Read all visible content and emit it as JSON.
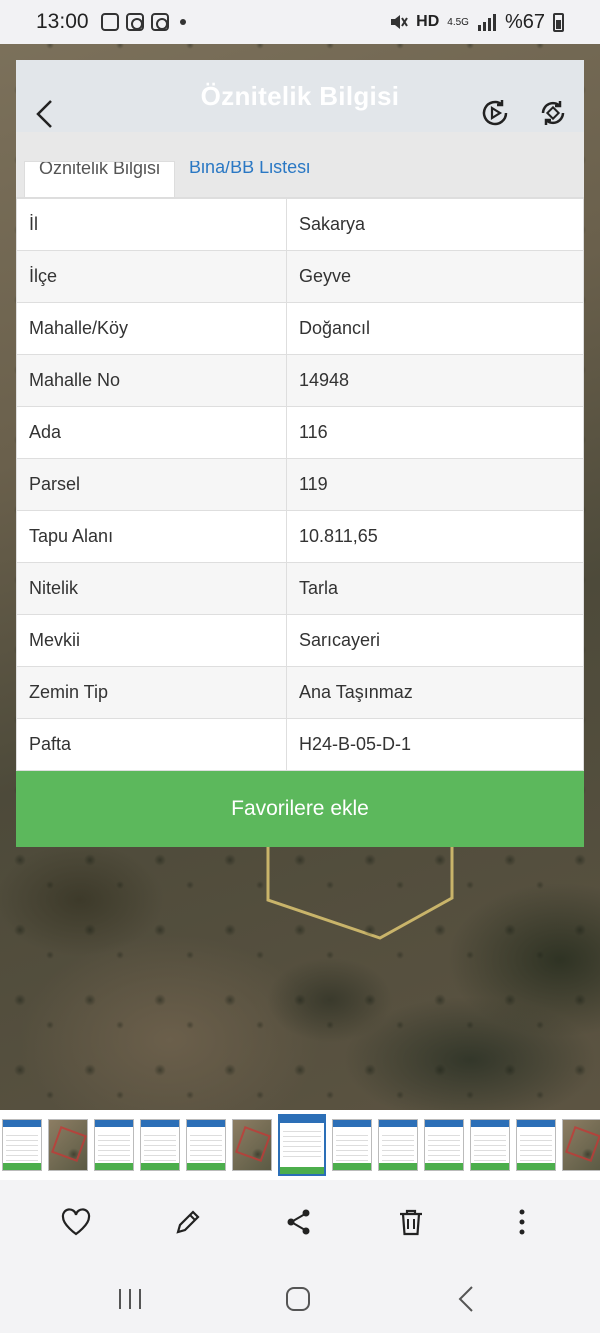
{
  "status_bar": {
    "time": "13:00",
    "network": "HD",
    "network_sub": "4.5G",
    "battery": "%67"
  },
  "app_bar": {
    "title": "Öznitelik Bilgisi"
  },
  "tabs": [
    {
      "label": "Öznitelik Bilgisi",
      "active": true
    },
    {
      "label": "Bina/BB Listesi",
      "active": false
    }
  ],
  "attributes": [
    {
      "key": "İl",
      "value": "Sakarya"
    },
    {
      "key": "İlçe",
      "value": "Geyve"
    },
    {
      "key": "Mahalle/Köy",
      "value": "Doğancıl"
    },
    {
      "key": "Mahalle No",
      "value": "14948"
    },
    {
      "key": "Ada",
      "value": "116"
    },
    {
      "key": "Parsel",
      "value": "119"
    },
    {
      "key": "Tapu Alanı",
      "value": "10.811,65"
    },
    {
      "key": "Nitelik",
      "value": "Tarla"
    },
    {
      "key": "Mevkii",
      "value": "Sarıcayeri"
    },
    {
      "key": "Zemin Tip",
      "value": "Ana Taşınmaz"
    },
    {
      "key": "Pafta",
      "value": "H24-B-05-D-1"
    }
  ],
  "favorite_button": {
    "label": "Favorilere ekle"
  },
  "colors": {
    "accent_green": "#5cb85c",
    "tab_link_blue": "#2a78c4",
    "parcel_outline": "#c9b46a"
  },
  "thumbnails": [
    "doc",
    "map",
    "doc",
    "doc",
    "doc",
    "map",
    "doc-current",
    "doc",
    "doc",
    "doc",
    "doc",
    "doc",
    "map"
  ],
  "bottom_actions": [
    {
      "icon": "heart-icon"
    },
    {
      "icon": "pencil-icon"
    },
    {
      "icon": "share-icon"
    },
    {
      "icon": "trash-icon"
    },
    {
      "icon": "more-vertical-icon"
    }
  ],
  "nav": [
    {
      "icon": "recent-apps-icon"
    },
    {
      "icon": "home-icon"
    },
    {
      "icon": "nav-back-icon"
    }
  ]
}
